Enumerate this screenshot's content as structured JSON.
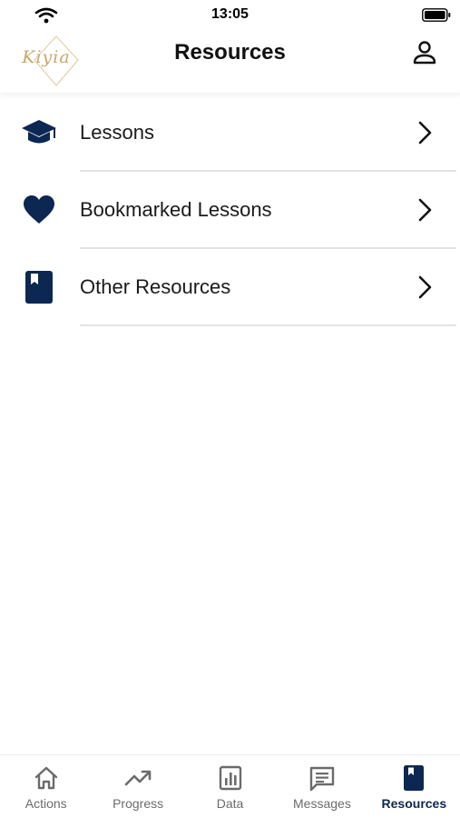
{
  "status_bar": {
    "time": "13:05"
  },
  "header": {
    "title": "Resources",
    "logo_text": "Kiyia"
  },
  "menu": {
    "items": [
      {
        "label": "Lessons",
        "icon": "graduation-cap-icon"
      },
      {
        "label": "Bookmarked Lessons",
        "icon": "heart-icon"
      },
      {
        "label": "Other Resources",
        "icon": "book-icon"
      }
    ]
  },
  "tab_bar": {
    "items": [
      {
        "label": "Actions",
        "icon": "home-icon",
        "active": false
      },
      {
        "label": "Progress",
        "icon": "trending-up-icon",
        "active": false
      },
      {
        "label": "Data",
        "icon": "bar-chart-icon",
        "active": false
      },
      {
        "label": "Messages",
        "icon": "message-icon",
        "active": false
      },
      {
        "label": "Resources",
        "icon": "book-icon",
        "active": true
      }
    ]
  },
  "colors": {
    "accent": "#0c2752",
    "logo_gold": "#c9a868",
    "inactive": "#6b6b6b",
    "divider": "#e3e3e3"
  }
}
